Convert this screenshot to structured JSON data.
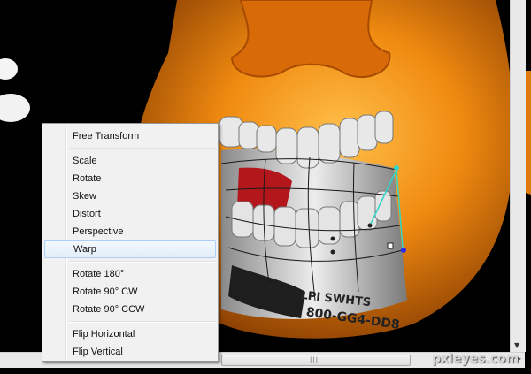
{
  "context_menu": {
    "groups": [
      [
        {
          "label": "Free Transform",
          "name": "menu-item-free-transform"
        }
      ],
      [
        {
          "label": "Scale",
          "name": "menu-item-scale"
        },
        {
          "label": "Rotate",
          "name": "menu-item-rotate"
        },
        {
          "label": "Skew",
          "name": "menu-item-skew"
        },
        {
          "label": "Distort",
          "name": "menu-item-distort"
        },
        {
          "label": "Perspective",
          "name": "menu-item-perspective"
        },
        {
          "label": "Warp",
          "name": "menu-item-warp",
          "highlighted": true
        }
      ],
      [
        {
          "label": "Rotate 180°",
          "name": "menu-item-rotate-180"
        },
        {
          "label": "Rotate 90° CW",
          "name": "menu-item-rotate-90-cw"
        },
        {
          "label": "Rotate 90° CCW",
          "name": "menu-item-rotate-90-ccw"
        }
      ],
      [
        {
          "label": "Flip Horizontal",
          "name": "menu-item-flip-horizontal"
        },
        {
          "label": "Flip Vertical",
          "name": "menu-item-flip-vertical"
        }
      ]
    ]
  },
  "canvas_art": {
    "label_text_1": "2LPI SWHTS",
    "label_text_2": "800-GG4-DD8"
  },
  "watermark": "pxleyes.com",
  "colors": {
    "orange_body": "#f08a10",
    "menu_highlight": "#e3eef9",
    "warp_grid": "#1a1a1a",
    "warp_handle": "#2fd6c8"
  }
}
